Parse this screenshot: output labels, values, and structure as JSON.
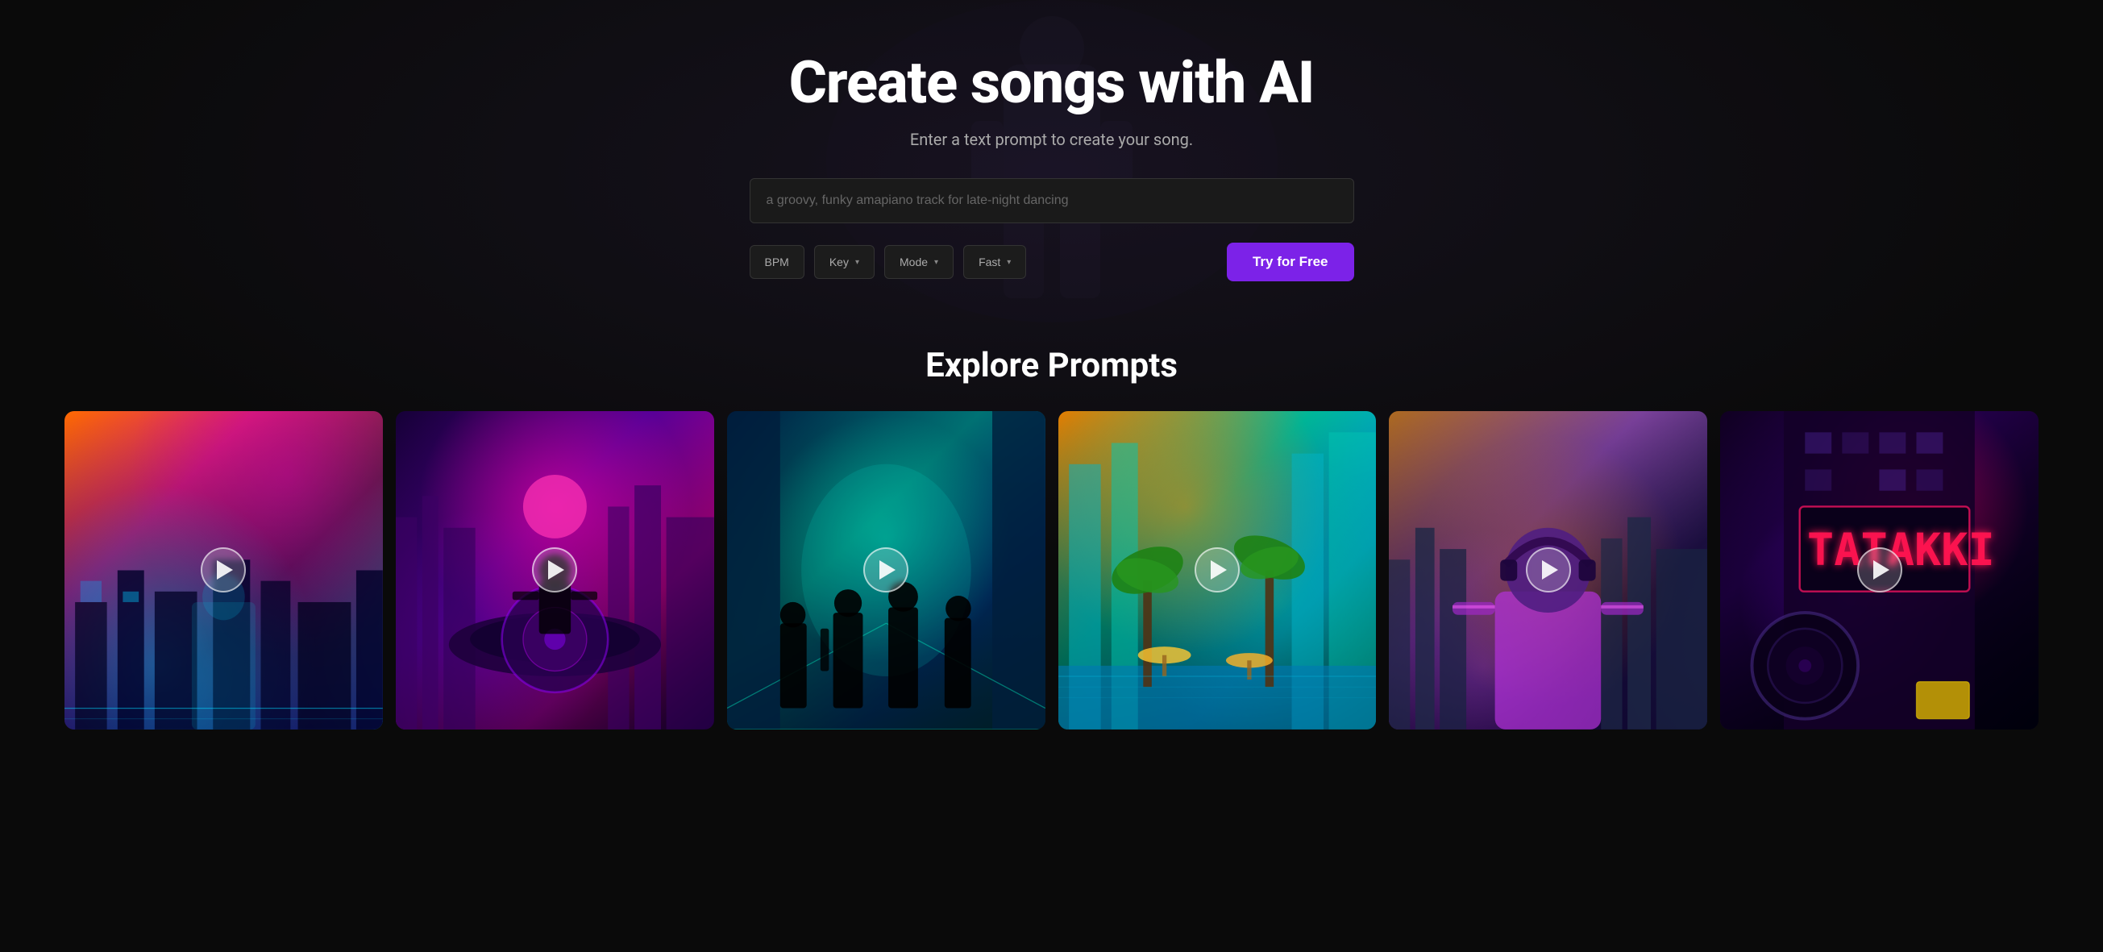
{
  "hero": {
    "title": "Create songs with AI",
    "subtitle": "Enter a text prompt to create your song.",
    "search_placeholder": "a groovy, funky amapiano track for late-night dancing",
    "search_value": ""
  },
  "controls": {
    "bpm_label": "BPM",
    "key_label": "Key",
    "key_arrow": "▾",
    "mode_label": "Mode",
    "mode_arrow": "▾",
    "fast_label": "Fast",
    "fast_arrow": "▾",
    "try_btn": "Try for Free"
  },
  "explore": {
    "title": "Explore Prompts",
    "cards": [
      {
        "id": 1,
        "alt": "Cyberpunk warrior with guitar"
      },
      {
        "id": 2,
        "alt": "DJ turntable neon city"
      },
      {
        "id": 3,
        "alt": "Band silhouettes in neon corridor"
      },
      {
        "id": 4,
        "alt": "Tropical cityscape with palms"
      },
      {
        "id": 5,
        "alt": "DJ with headphones cityscape"
      },
      {
        "id": 6,
        "alt": "Neon city sign at night"
      }
    ]
  }
}
